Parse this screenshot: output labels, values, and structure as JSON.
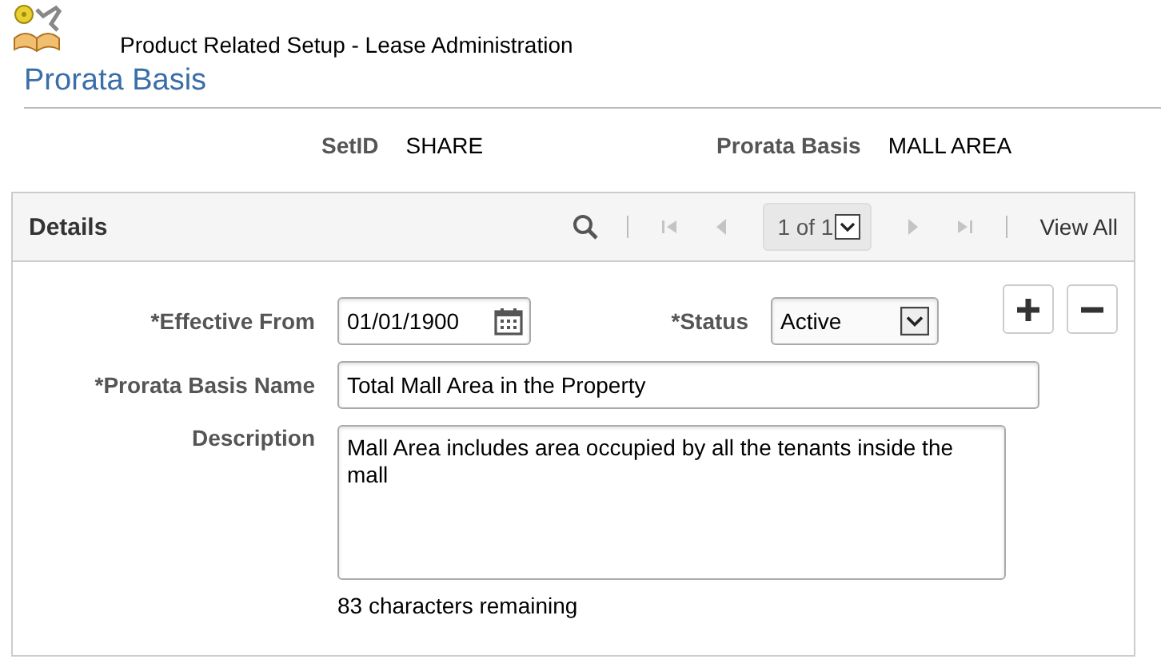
{
  "header": {
    "title": "Product Related Setup - Lease Administration"
  },
  "page_title": "Prorata Basis",
  "keys": [
    {
      "label": "SetID",
      "value": "SHARE"
    },
    {
      "label": "Prorata Basis",
      "value": "MALL AREA"
    }
  ],
  "details": {
    "title": "Details",
    "nav": [
      {
        "kind": "first",
        "disabled": true
      },
      {
        "kind": "prev",
        "disabled": true
      },
      {
        "kind": "page",
        "text": "1 of 1"
      },
      {
        "kind": "next",
        "disabled": true
      },
      {
        "kind": "last",
        "disabled": true
      }
    ],
    "view_all": "View All",
    "effective_from": {
      "label": "*Effective From",
      "value": "01/01/1900"
    },
    "status": {
      "label": "*Status",
      "value": "Active"
    },
    "name": {
      "label": "*Prorata Basis Name",
      "value": "Total Mall Area in the Property"
    },
    "description": {
      "label": "Description",
      "value": "Mall Area includes area occupied by all the tenants inside the mall"
    },
    "remaining": "83 characters remaining"
  }
}
